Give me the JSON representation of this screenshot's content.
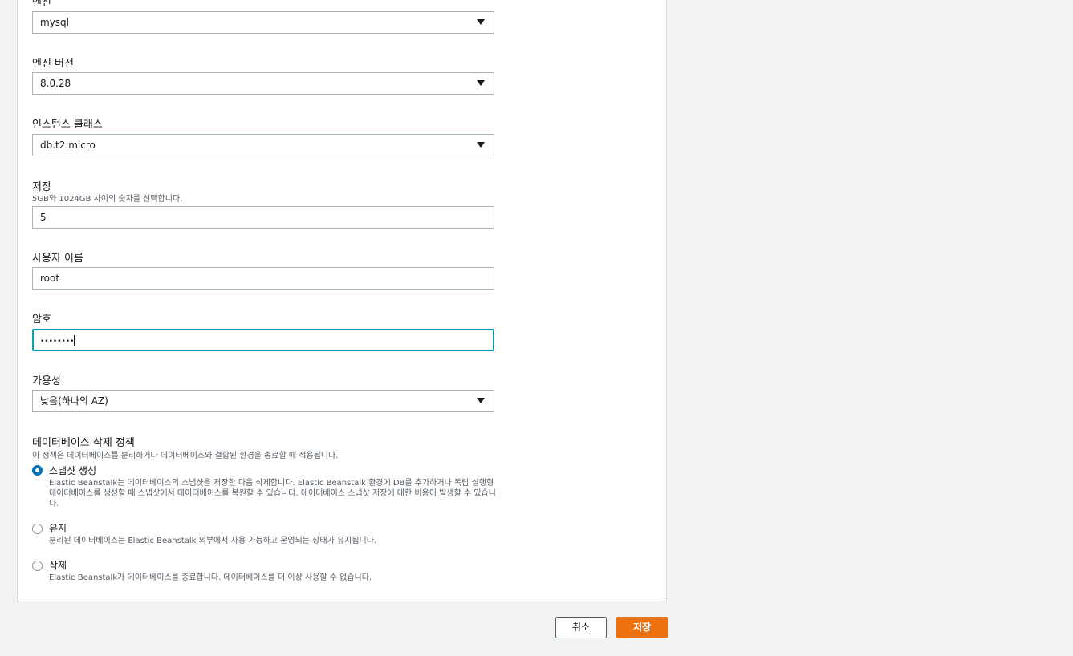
{
  "form": {
    "engine": {
      "label": "엔진",
      "value": "mysql"
    },
    "engine_version": {
      "label": "엔진 버전",
      "value": "8.0.28"
    },
    "instance_class": {
      "label": "인스턴스 클래스",
      "value": "db.t2.micro"
    },
    "storage": {
      "label": "저장",
      "hint": "5GB와 1024GB 사이의 숫자를 선택합니다.",
      "value": "5"
    },
    "username": {
      "label": "사용자 이름",
      "value": "root"
    },
    "password": {
      "label": "암호",
      "value": "••••••••"
    },
    "availability": {
      "label": "가용성",
      "value": "낮음(하나의 AZ)"
    },
    "deletion_policy": {
      "label": "데이터베이스 삭제 정책",
      "hint": "이 정책은 데이터베이스를 분리하거나 데이터베이스와 결합된 환경을 종료할 때 적용됩니다.",
      "options": [
        {
          "title": "스냅샷 생성",
          "desc": "Elastic Beanstalk는 데이터베이스의 스냅샷을 저장한 다음 삭제합니다. Elastic Beanstalk 환경에 DB를 추가하거나 독립 실행형 데이터베이스를 생성할 때 스냅샷에서 데이터베이스를 복원할 수 있습니다. 데이터베이스 스냅샷 저장에 대한 비용이 발생할 수 있습니다.",
          "selected": true
        },
        {
          "title": "유지",
          "desc": "분리된 데이터베이스는 Elastic Beanstalk 외부에서 사용 가능하고 운영되는 상태가 유지됩니다.",
          "selected": false
        },
        {
          "title": "삭제",
          "desc": "Elastic Beanstalk가 데이터베이스를 종료합니다. 데이터베이스를 더 이상 사용할 수 없습니다.",
          "selected": false
        }
      ]
    }
  },
  "actions": {
    "cancel_label": "취소",
    "save_label": "저장"
  },
  "colors": {
    "accent": "#ec7211",
    "focus": "#0a9fb5",
    "radio_selected": "#0073bb"
  },
  "icons": {
    "select_caret": "caret-down-icon"
  }
}
